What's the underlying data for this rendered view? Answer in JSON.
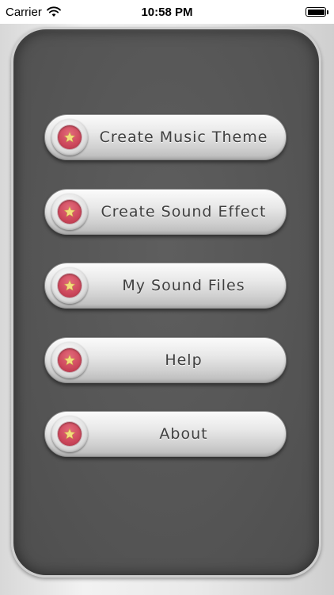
{
  "status_bar": {
    "carrier": "Carrier",
    "time": "10:58 PM",
    "icons": {
      "wifi": "wifi-icon",
      "battery": "battery-icon"
    }
  },
  "menu": {
    "icon": "star-icon",
    "items": [
      {
        "label": "Create Music Theme"
      },
      {
        "label": "Create Sound Effect"
      },
      {
        "label": "My Sound Files"
      },
      {
        "label": "Help"
      },
      {
        "label": "About"
      }
    ]
  },
  "colors": {
    "panel": "#555555",
    "button_text": "#3f3f3f",
    "badge_red": "#cf4a5e",
    "star_yellow": "#f3df7d"
  }
}
